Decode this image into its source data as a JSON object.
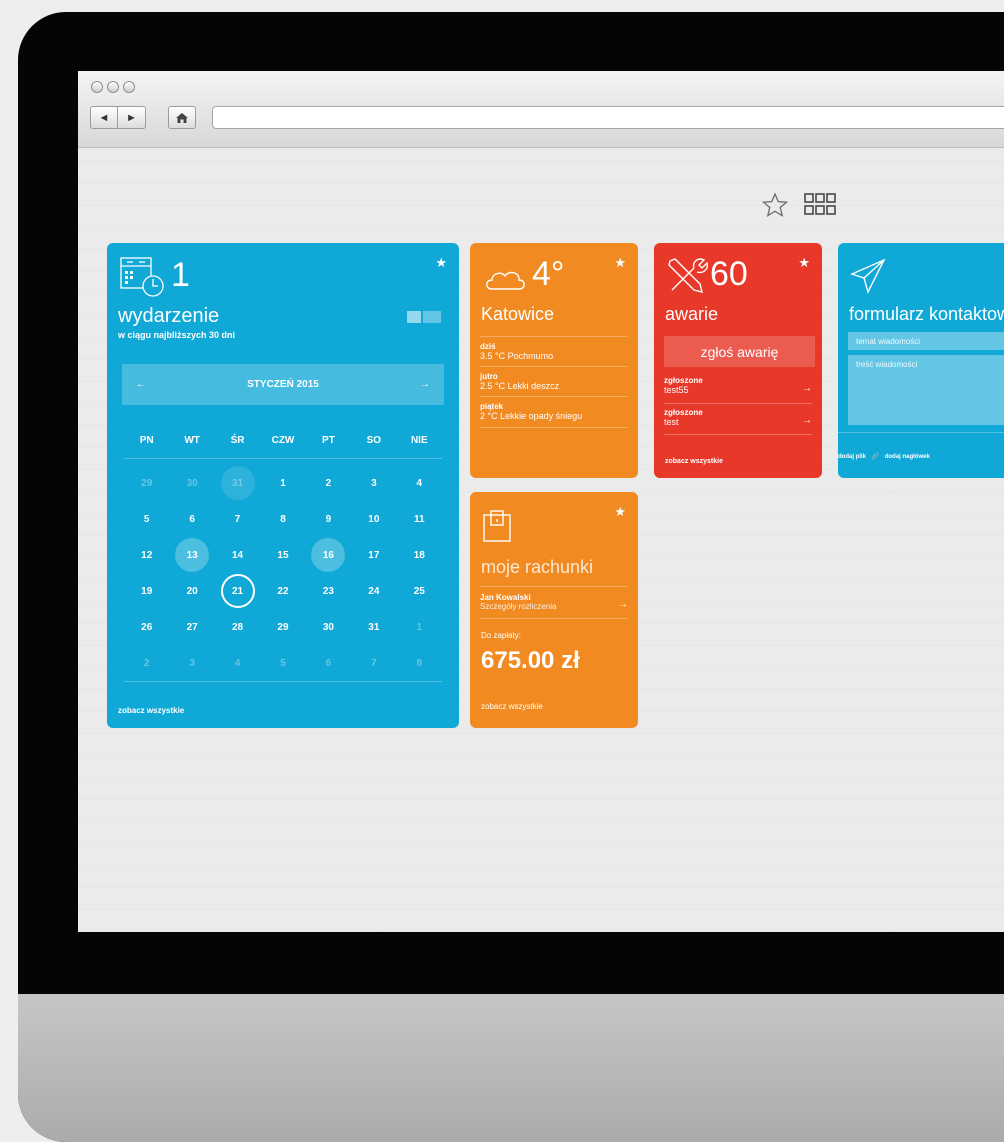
{
  "toolbar": {
    "back_label": "◄",
    "forward_label": "►"
  },
  "header": {
    "star_icon": "star-outline-icon",
    "grid_icon": "grid-icon"
  },
  "events_tile": {
    "count": "1",
    "title": "wydarzenie",
    "subtitle": "w ciągu najbliższych 30 dni",
    "month": "STYCZEŃ 2015",
    "prev_arrow": "←",
    "next_arrow": "→",
    "weekdays": [
      "PN",
      "WT",
      "ŚR",
      "CZW",
      "PT",
      "SO",
      "NIE"
    ],
    "weeks": [
      [
        "29",
        "30",
        "31",
        "1",
        "2",
        "3",
        "4"
      ],
      [
        "5",
        "6",
        "7",
        "8",
        "9",
        "10",
        "11"
      ],
      [
        "12",
        "13",
        "14",
        "15",
        "16",
        "17",
        "18"
      ],
      [
        "19",
        "20",
        "21",
        "22",
        "23",
        "24",
        "25"
      ],
      [
        "26",
        "27",
        "28",
        "29",
        "30",
        "31",
        "1"
      ],
      [
        "2",
        "3",
        "4",
        "5",
        "6",
        "7",
        "8"
      ]
    ],
    "see_all": "zobacz wszystkie"
  },
  "weather_tile": {
    "temp": "4°",
    "city": "Katowice",
    "days": [
      {
        "day": "dziś",
        "forecast": "3.5 °C Pochmumo"
      },
      {
        "day": "jutro",
        "forecast": "2.5 °C Lekki deszcz"
      },
      {
        "day": "piątek",
        "forecast": "2 °C Lekkie opady śniegu"
      }
    ]
  },
  "failures_tile": {
    "count": "60",
    "title": "awarie",
    "report_button": "zgłoś awarię",
    "items": [
      {
        "status": "zgłoszone",
        "name": "test55"
      },
      {
        "status": "zgłoszone",
        "name": "test"
      }
    ],
    "see_all": "zobacz wszystkie"
  },
  "bills_tile": {
    "title": "moje rachunki",
    "person": "Jan Kowalski",
    "details": "Szczegóły rozliczenia",
    "due_label": "Do zapłaty:",
    "amount": "675.00 zł",
    "see_all": "zobacz wszystkie"
  },
  "contact_tile": {
    "title": "formularz kontaktowy",
    "subject_placeholder": "temat wiadomości",
    "body_placeholder": "treść wiadomości",
    "add_file": "dodaj plik",
    "add_header": "dodaj nagłówek"
  },
  "colors": {
    "blue": "#10a8d6",
    "orange": "#f28a22",
    "red": "#e8382a"
  }
}
